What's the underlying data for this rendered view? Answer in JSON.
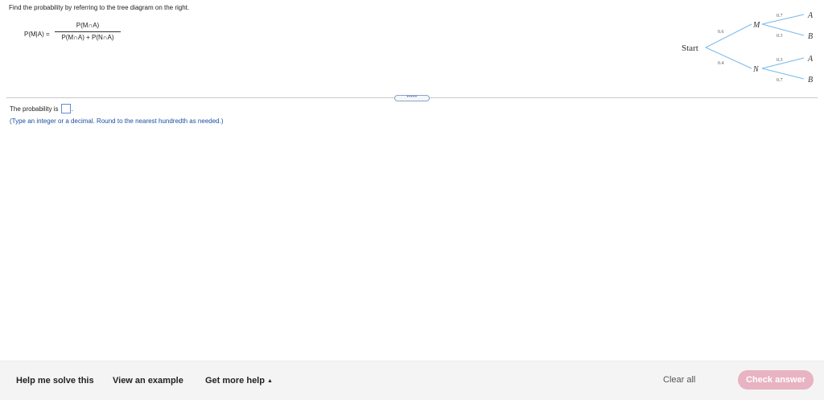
{
  "question": {
    "instruction": "Find the probability by referring to the tree diagram on the right.",
    "formula": {
      "lhs": "P(M|A) =",
      "numerator": "P(M∩A)",
      "denominator": "P(M∩A) + P(N∩A)"
    }
  },
  "tree": {
    "start_label": "Start",
    "first_level": [
      {
        "label": "M",
        "prob": "0.6"
      },
      {
        "label": "N",
        "prob": "0.4"
      }
    ],
    "second_level": {
      "M": [
        {
          "label": "A",
          "prob": "0.7"
        },
        {
          "label": "B",
          "prob": "0.3"
        }
      ],
      "N": [
        {
          "label": "A",
          "prob": "0.3"
        },
        {
          "label": "B",
          "prob": "0.7"
        }
      ]
    },
    "line_color": "#7ab8e8"
  },
  "divider_handle": "•••••",
  "answer": {
    "prefix": "The probability is",
    "suffix": ".",
    "value": "",
    "hint": "(Type an integer or a decimal. Round to the nearest hundredth as needed.)"
  },
  "footer": {
    "help_me_solve": "Help me solve this",
    "view_example": "View an example",
    "get_more_help": "Get more help",
    "more_help_caret": "▲",
    "clear_all": "Clear all",
    "check_answer": "Check answer",
    "check_answer_color": "#e8b3c2"
  }
}
